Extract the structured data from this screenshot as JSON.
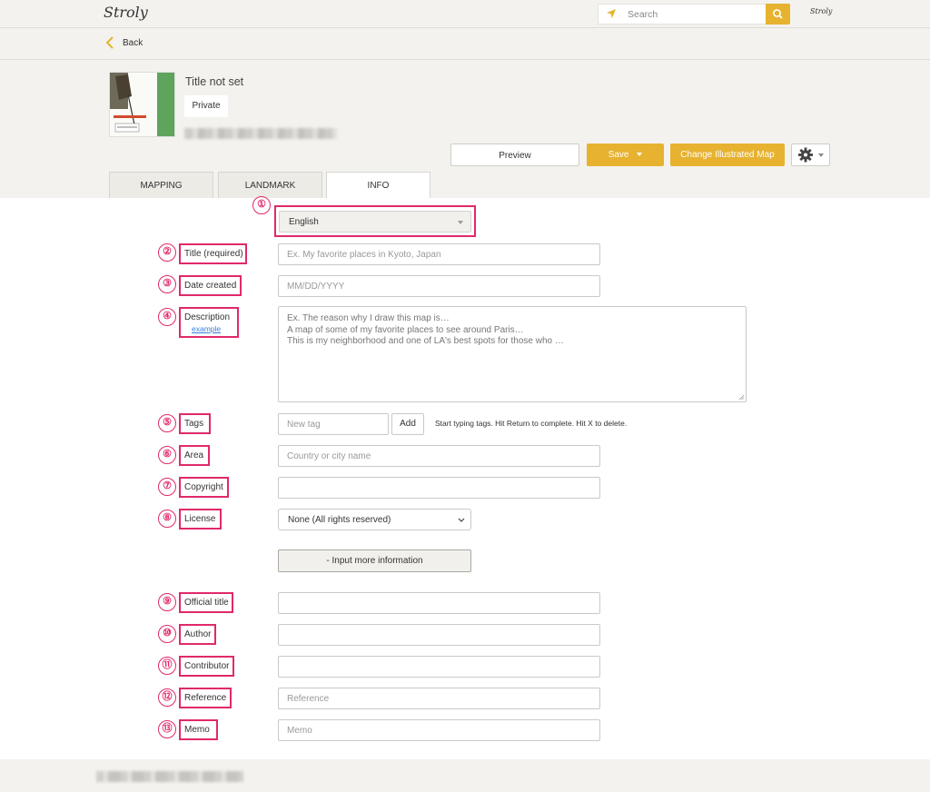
{
  "header": {
    "logo": "Stroly",
    "search_placeholder": "Search",
    "user_avatar": "Stroly"
  },
  "nav": {
    "back_label": "Back"
  },
  "map": {
    "title": "Title not set",
    "visibility": "Private"
  },
  "actions": {
    "preview": "Preview",
    "save": "Save",
    "change_map": "Change Illustrated Map"
  },
  "tabs": [
    "MAPPING",
    "LANDMARK",
    "INFO"
  ],
  "colors": {
    "accent": "#e6b230",
    "highlight": "#e0296b",
    "link": "#3b7dd8"
  },
  "form": {
    "language": "English",
    "markers": [
      "①",
      "②",
      "③",
      "④",
      "⑤",
      "⑥",
      "⑦",
      "⑧",
      "⑨",
      "⑩",
      "⑪",
      "⑫",
      "⑬"
    ],
    "title_label": "Title (required)",
    "title_placeholder": "Ex. My favorite places in Kyoto, Japan",
    "date_label": "Date created",
    "date_placeholder": "MM/DD/YYYY",
    "description_label": "Description",
    "description_example": "example",
    "description_placeholder": [
      "Ex. The reason why I draw this map is…",
      "A map of some of my favorite places to see around Paris…",
      "This is my neighborhood and one of LA's best spots for those who …"
    ],
    "tags_label": "Tags",
    "tags_placeholder": "New tag",
    "tags_add": "Add",
    "tags_hint": "Start typing tags. Hit Return to complete. Hit X to delete.",
    "area_label": "Area",
    "area_placeholder": "Country or city name",
    "copyright_label": "Copyright",
    "license_label": "License",
    "license_value": "None (All rights reserved)",
    "more_info": "-   Input more information",
    "official_title_label": "Official title",
    "author_label": "Author",
    "contributor_label": "Contributor",
    "reference_label": "Reference",
    "reference_placeholder": "Reference",
    "memo_label": "Memo",
    "memo_placeholder": "Memo"
  }
}
